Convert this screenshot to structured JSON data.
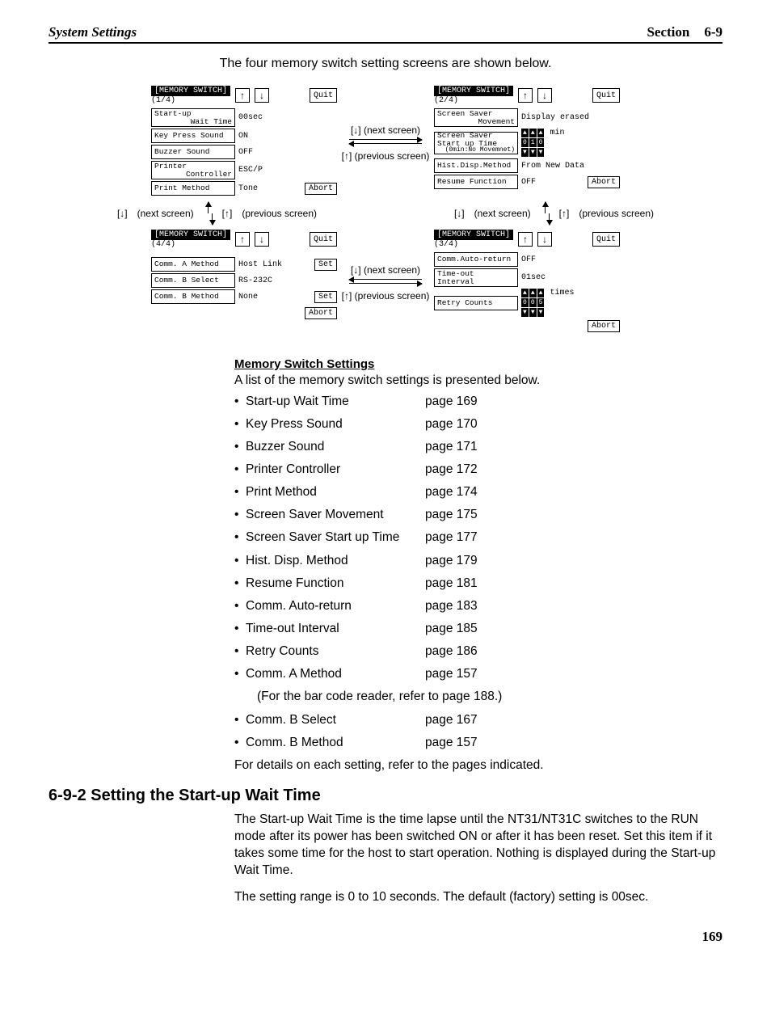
{
  "header": {
    "left": "System Settings",
    "section_label": "Section",
    "section_num": "6-9"
  },
  "intro": "The four memory switch setting screens are shown below.",
  "nav_labels": {
    "next": "(next screen)",
    "prev": "(previous screen)"
  },
  "buttons": {
    "quit": "Quit",
    "abort": "Abort",
    "set": "Set",
    "up": "↑",
    "down": "↓"
  },
  "panels": {
    "p1": {
      "title": "[MEMORY SWITCH]",
      "page": "(1/4)",
      "rows": [
        {
          "label1": "Start-up",
          "label2": "Wait Time",
          "value": "00sec"
        },
        {
          "label1": "Key Press Sound",
          "value": "ON"
        },
        {
          "label1": "Buzzer Sound",
          "value": "OFF"
        },
        {
          "label1": "Printer",
          "label2": "Controller",
          "value": "ESC/P"
        },
        {
          "label1": "Print Method",
          "value": "Tone"
        }
      ]
    },
    "p2": {
      "title": "[MEMORY SWITCH]",
      "page": "(2/4)",
      "rows": [
        {
          "label1": "Screen Saver",
          "label2": "Movement",
          "value": "Display erased"
        },
        {
          "label1": "Screen Saver",
          "label2": "Start up Time",
          "label3": "(0min:No Movemnet)",
          "value": "010",
          "unit": "min",
          "num": true
        },
        {
          "label1": "Hist.Disp.Method",
          "value": "From New Data"
        },
        {
          "label1": "Resume Function",
          "value": "OFF"
        }
      ]
    },
    "p4": {
      "title": "[MEMORY SWITCH]",
      "page": "(4/4)",
      "rows": [
        {
          "label1": "Comm. A Method",
          "value": "Host Link",
          "set": true
        },
        {
          "label1": "Comm. B Select",
          "value": "RS-232C"
        },
        {
          "label1": "Comm. B Method",
          "value": "None",
          "set": true
        }
      ]
    },
    "p3": {
      "title": "[MEMORY SWITCH]",
      "page": "(3/4)",
      "rows": [
        {
          "label1": "Comm.Auto-return",
          "value": "OFF"
        },
        {
          "label1": "Time-out Interval",
          "value": "01sec"
        },
        {
          "label1": "Retry Counts",
          "value": "005",
          "unit": "times",
          "num": true
        }
      ]
    }
  },
  "memswitch": {
    "heading": "Memory Switch Settings",
    "lead": "A list of the memory switch settings is presented below.",
    "items": [
      {
        "name": "Start-up Wait Time",
        "page": "page 169"
      },
      {
        "name": "Key Press Sound",
        "page": "page 170"
      },
      {
        "name": "Buzzer Sound",
        "page": "page 171"
      },
      {
        "name": "Printer Controller",
        "page": "page 172"
      },
      {
        "name": "Print Method",
        "page": "page 174"
      },
      {
        "name": "Screen Saver Movement",
        "page": "page 175"
      },
      {
        "name": "Screen Saver Start up Time",
        "page": "page 177"
      },
      {
        "name": "Hist. Disp. Method",
        "page": "page 179"
      },
      {
        "name": "Resume Function",
        "page": "page 181"
      },
      {
        "name": "Comm. Auto-return",
        "page": "page 183"
      },
      {
        "name": "Time-out Interval",
        "page": "page 185"
      },
      {
        "name": "Retry Counts",
        "page": "page 186"
      },
      {
        "name": "Comm. A Method",
        "page": "page 157"
      }
    ],
    "note": "(For the bar code reader, refer to page 188.)",
    "items2": [
      {
        "name": "Comm. B Select",
        "page": "page 167"
      },
      {
        "name": "Comm. B Method",
        "page": "page 157"
      }
    ],
    "tail": "For details on each setting, refer to the pages indicated."
  },
  "section692": {
    "heading": "6-9-2  Setting the Start-up Wait Time",
    "p1": "The Start-up Wait Time is the time lapse until the NT31/NT31C switches to the RUN mode after its power has been switched ON or after it has been reset. Set this item if it takes some time for the host to start operation. Nothing is displayed during the Start-up Wait Time.",
    "p2": "The setting range is 0 to 10 seconds. The default (factory) setting is 00sec."
  },
  "page_number": "169"
}
